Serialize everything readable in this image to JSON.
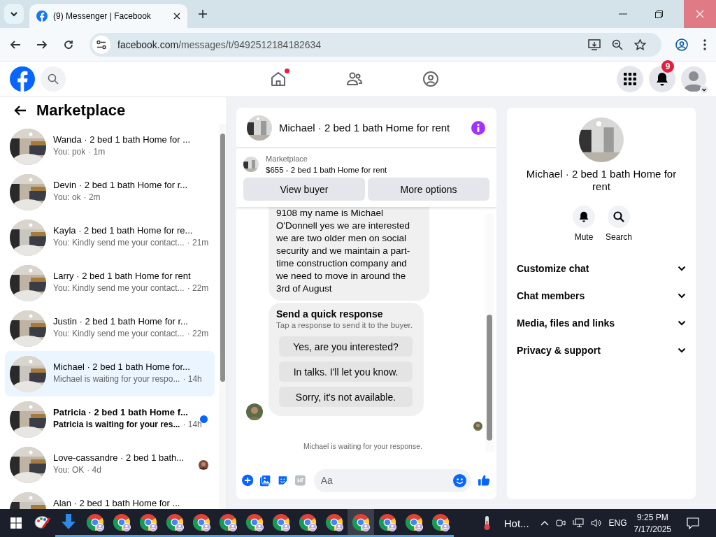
{
  "browser": {
    "tab_title": "(9) Messenger | Facebook",
    "url_host": "facebook.com",
    "url_path": "/messages/t/9492512184182634"
  },
  "topbar": {
    "home_unread": true,
    "notification_count": "9"
  },
  "sidebar": {
    "title": "Marketplace",
    "conversations": [
      {
        "name": "Wanda · 2 bed 1 bath Home for ...",
        "preview": "You: pok",
        "time": "· 1m",
        "selected": false,
        "unread": false,
        "seen_by": false
      },
      {
        "name": "Devin · 2 bed 1 bath Home for r...",
        "preview": "You: ok",
        "time": "· 2m",
        "selected": false,
        "unread": false,
        "seen_by": false
      },
      {
        "name": "Kayla · 2 bed 1 bath Home for re...",
        "preview": "You: Kindly send me your contact...",
        "time": "· 21m",
        "selected": false,
        "unread": false,
        "seen_by": false
      },
      {
        "name": "Larry · 2 bed 1 bath Home for rent",
        "preview": "You: Kindly send me your contact...",
        "time": "· 22m",
        "selected": false,
        "unread": false,
        "seen_by": false
      },
      {
        "name": "Justin · 2 bed 1 bath Home for r...",
        "preview": "You: Kindly send me your contact...",
        "time": "· 22m",
        "selected": false,
        "unread": false,
        "seen_by": false
      },
      {
        "name": "Michael · 2 bed 1 bath Home for...",
        "preview": "Michael is waiting for your respo...",
        "time": "· 14h",
        "selected": true,
        "unread": false,
        "seen_by": false
      },
      {
        "name": "Patricia · 2 bed 1 bath Home f...",
        "preview": "Patricia is waiting for your res...",
        "time": "· 14h",
        "selected": false,
        "unread": true,
        "seen_by": false
      },
      {
        "name": "Love-cassandre · 2 bed 1 bath...",
        "preview": "You: OK",
        "time": "· 4d",
        "selected": false,
        "unread": false,
        "seen_by": true
      },
      {
        "name": "Alan · 2 bed 1 bath Home for ...",
        "selected": false,
        "unread": false,
        "seen_by": false
      }
    ]
  },
  "chat": {
    "title": "Michael · 2 bed 1 bath Home for rent",
    "listing": {
      "label": "Marketplace",
      "title": "$655 - 2 bed 1 bath Home for rent",
      "buttons": [
        "View buyer",
        "More options"
      ]
    },
    "message": "9108 my name is Michael O'Donnell yes we are interested we are two older men on social security and we maintain a part-time construction company and we need to move in around the 3rd of August",
    "quick_response": {
      "title": "Send a quick response",
      "subtitle": "Tap a response to send it to the buyer.",
      "options": [
        "Yes, are you interested?",
        "In talks. I'll let you know.",
        "Sorry, it's not available."
      ]
    },
    "status": "Michael is waiting for your response.",
    "composer": {
      "placeholder": "Aa"
    }
  },
  "details": {
    "title": "Michael · 2 bed 1 bath Home for rent",
    "actions": [
      {
        "kind": "mute",
        "label": "Mute"
      },
      {
        "kind": "search",
        "label": "Search"
      }
    ],
    "sections": [
      {
        "label": "Customize chat",
        "expanded": false
      },
      {
        "label": "Chat members",
        "expanded": false
      },
      {
        "label": "Media, files and links",
        "expanded": false
      },
      {
        "label": "Privacy & support",
        "expanded": false
      }
    ]
  },
  "taskbar": {
    "apps": [
      {
        "kind": "paint",
        "active": false
      },
      {
        "kind": "download",
        "active": false
      },
      {
        "kind": "chrome",
        "active": false
      },
      {
        "kind": "chrome",
        "active": false
      },
      {
        "kind": "chrome",
        "active": false
      },
      {
        "kind": "chrome",
        "active": false
      },
      {
        "kind": "chrome",
        "active": false
      },
      {
        "kind": "chrome",
        "active": false
      },
      {
        "kind": "chrome",
        "active": false
      },
      {
        "kind": "chrome",
        "active": false
      },
      {
        "kind": "chrome",
        "active": false
      },
      {
        "kind": "chrome",
        "active": false
      },
      {
        "kind": "chrome",
        "active": true
      },
      {
        "kind": "chrome",
        "active": false
      },
      {
        "kind": "chrome",
        "active": false
      },
      {
        "kind": "chrome",
        "active": false
      }
    ],
    "weather": "Hot...",
    "language": "ENG",
    "time": "9:25 PM",
    "date": "7/17/2025"
  }
}
